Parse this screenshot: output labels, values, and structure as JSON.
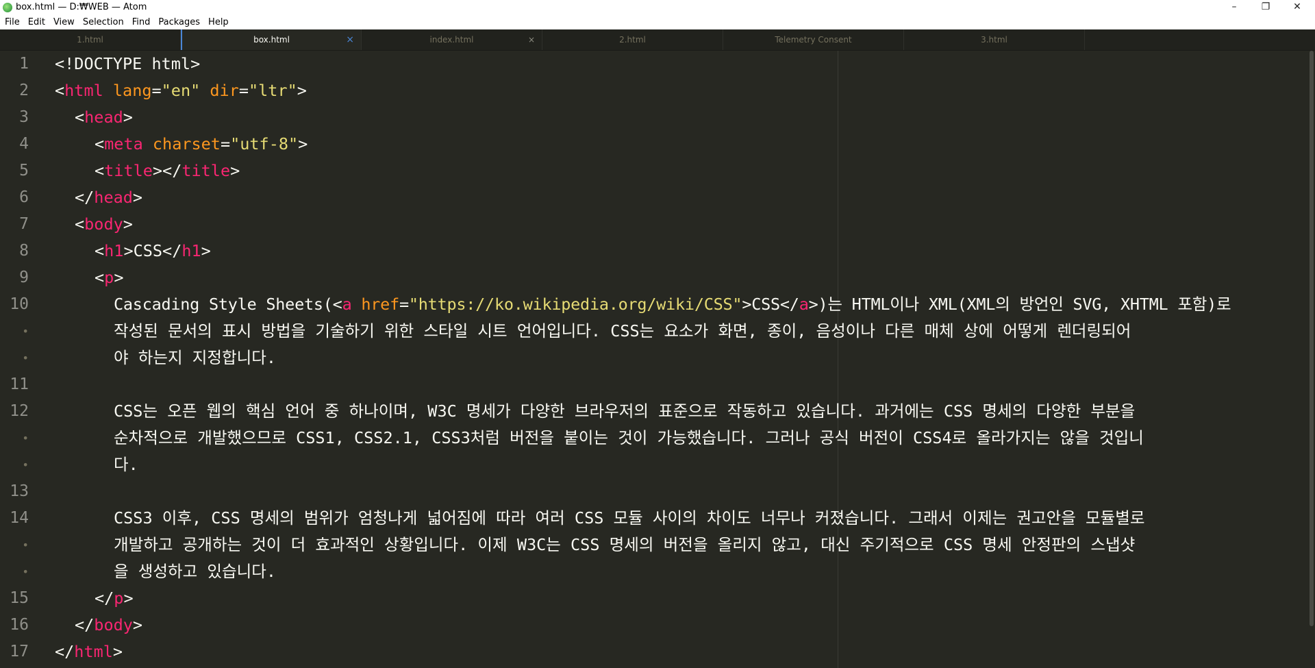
{
  "window": {
    "title": "box.html — D:₩WEB — Atom",
    "minimize": "–",
    "maximize": "❐",
    "close": "✕"
  },
  "menu": [
    "File",
    "Edit",
    "View",
    "Selection",
    "Find",
    "Packages",
    "Help"
  ],
  "tabs": [
    {
      "label": "1.html",
      "active": false,
      "close": ""
    },
    {
      "label": "box.html",
      "active": true,
      "close": "×"
    },
    {
      "label": "index.html",
      "active": false,
      "close": "×"
    },
    {
      "label": "2.html",
      "active": false,
      "close": ""
    },
    {
      "label": "Telemetry Consent",
      "active": false,
      "close": ""
    },
    {
      "label": "3.html",
      "active": false,
      "close": ""
    }
  ],
  "gutter": [
    "1",
    "2",
    "3",
    "4",
    "5",
    "6",
    "7",
    "8",
    "9",
    "10",
    "•",
    "•",
    "11",
    "12",
    "•",
    "•",
    "13",
    "14",
    "•",
    "•",
    "15",
    "16",
    "17"
  ],
  "colors": {
    "background": "#272822",
    "tag": "#f92672",
    "attribute": "#fd971f",
    "string": "#e6db74",
    "text": "#f8f8f2",
    "active_tab_accent": "#4a86d6"
  },
  "code": {
    "l1": {
      "punc": "<!DOCTYPE html>"
    },
    "l2": {
      "open": "<",
      "tag": "html",
      "a1": "lang",
      "eq1": "=",
      "v1": "\"en\"",
      "a2": "dir",
      "eq2": "=",
      "v2": "\"ltr\"",
      "close": ">"
    },
    "l3": {
      "open": "<",
      "tag": "head",
      "close": ">"
    },
    "l4": {
      "open": "<",
      "tag": "meta",
      "a1": "charset",
      "eq1": "=",
      "v1": "\"utf-8\"",
      "close": ">"
    },
    "l5": {
      "open": "<",
      "tag": "title",
      "mid": "></",
      "tag2": "title",
      "close": ">"
    },
    "l6": {
      "open": "</",
      "tag": "head",
      "close": ">"
    },
    "l7": {
      "open": "<",
      "tag": "body",
      "close": ">"
    },
    "l8": {
      "open": "<",
      "tag": "h1",
      "mid": ">CSS</",
      "tag2": "h1",
      "close": ">"
    },
    "l9": {
      "open": "<",
      "tag": "p",
      "close": ">"
    },
    "l10a": {
      "pre": "Cascading Style Sheets(<",
      "tag": "a",
      "a1": "href",
      "eq1": "=",
      "v1": "\"https://ko.wikipedia.org/wiki/CSS\"",
      "mid": ">CSS</",
      "tag2": "a",
      "post": ">)는 HTML이나 XML(XML의 방언인 SVG, XHTML 포함)로"
    },
    "l10b": "작성된 문서의 표시 방법을 기술하기 위한 스타일 시트 언어입니다. CSS는 요소가 화면, 종이, 음성이나 다른 매체 상에 어떻게 렌더링되어",
    "l10c": "야 하는지 지정합니다.",
    "l12a": "CSS는 오픈 웹의 핵심 언어 중 하나이며, W3C 명세가 다양한 브라우저의 표준으로 작동하고 있습니다. 과거에는 CSS 명세의 다양한 부분을",
    "l12b": "순차적으로 개발했으므로 CSS1, CSS2.1, CSS3처럼 버전을 붙이는 것이 가능했습니다. 그러나 공식 버전이 CSS4로 올라가지는 않을 것입니",
    "l12c": "다.",
    "l14a": "CSS3 이후, CSS 명세의 범위가 엄청나게 넓어짐에 따라 여러 CSS 모듈 사이의 차이도 너무나 커졌습니다. 그래서 이제는 권고안을 모듈별로",
    "l14b": "개발하고 공개하는 것이 더 효과적인 상황입니다. 이제 W3C는 CSS 명세의 버전을 올리지 않고, 대신 주기적으로 CSS 명세 안정판의 스냅샷",
    "l14c": "을 생성하고 있습니다.",
    "l15": {
      "open": "</",
      "tag": "p",
      "close": ">"
    },
    "l16": {
      "open": "</",
      "tag": "body",
      "close": ">"
    },
    "l17": {
      "open": "</",
      "tag": "html",
      "close": ">"
    }
  }
}
